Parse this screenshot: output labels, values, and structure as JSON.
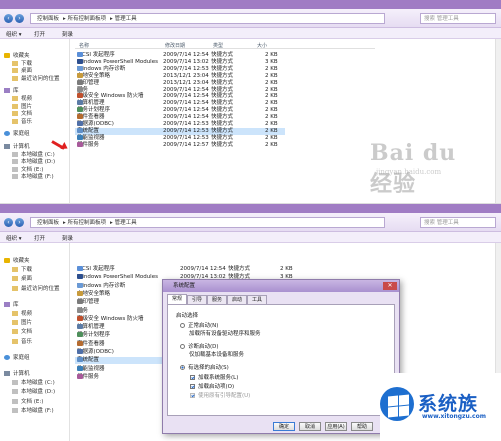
{
  "explorer": {
    "address": [
      "控制面板",
      "所有控制面板项",
      "管理工具"
    ],
    "search_placeholder": "搜索 管理工具",
    "toolbar": {
      "organize": "组织 ▾",
      "open": "打开",
      "burn": "刻录"
    },
    "columns": {
      "name": "名称",
      "modified": "修改日期",
      "type": "类型",
      "size": "大小"
    },
    "nav": [
      {
        "label": "收藏夹",
        "icon": "star-icon",
        "kind": "star",
        "indent": 0
      },
      {
        "label": "下载",
        "icon": "folder-icon",
        "kind": "folder",
        "indent": 1
      },
      {
        "label": "桌面",
        "icon": "folder-icon",
        "kind": "folder",
        "indent": 1
      },
      {
        "label": "最近访问的位置",
        "icon": "folder-icon",
        "kind": "folder",
        "indent": 1
      },
      {
        "label": "库",
        "icon": "library-icon",
        "kind": "lib",
        "indent": 0
      },
      {
        "label": "视频",
        "icon": "folder-icon",
        "kind": "folder",
        "indent": 1
      },
      {
        "label": "图片",
        "icon": "folder-icon",
        "kind": "folder",
        "indent": 1
      },
      {
        "label": "文档",
        "icon": "folder-icon",
        "kind": "folder",
        "indent": 1
      },
      {
        "label": "音乐",
        "icon": "folder-icon",
        "kind": "folder",
        "indent": 1
      },
      {
        "label": "家庭组",
        "icon": "network-icon",
        "kind": "net",
        "indent": 0
      },
      {
        "label": "计算机",
        "icon": "computer-icon",
        "kind": "pc",
        "indent": 0
      },
      {
        "label": "本地磁盘 (C:)",
        "icon": "drive-icon",
        "kind": "drive",
        "indent": 1
      },
      {
        "label": "本地磁盘 (D:)",
        "icon": "drive-icon",
        "kind": "drive",
        "indent": 1
      },
      {
        "label": "文档 (E:)",
        "icon": "drive-icon",
        "kind": "drive",
        "indent": 1
      },
      {
        "label": "本地磁盘 (F:)",
        "icon": "drive-icon",
        "kind": "drive",
        "indent": 1
      }
    ],
    "files": [
      {
        "name": "iSCSI 发起程序",
        "date": "2009/7/14 12:54",
        "type": "快捷方式",
        "size": "2 KB",
        "color": "#5a8fd8"
      },
      {
        "name": "Windows PowerShell Modules",
        "date": "2009/7/14 13:02",
        "type": "快捷方式",
        "size": "3 KB",
        "color": "#2d4f8f"
      },
      {
        "name": "Windows 内存诊断",
        "date": "2009/7/14 12:53",
        "type": "快捷方式",
        "size": "2 KB",
        "color": "#6a9ad6"
      },
      {
        "name": "本地安全策略",
        "date": "2013/12/1 23:04",
        "type": "快捷方式",
        "size": "2 KB",
        "color": "#c89b3c"
      },
      {
        "name": "打印管理",
        "date": "2013/12/1 23:04",
        "type": "快捷方式",
        "size": "2 KB",
        "color": "#7b7b7b"
      },
      {
        "name": "服务",
        "date": "2009/7/14 12:54",
        "type": "快捷方式",
        "size": "2 KB",
        "color": "#8a8a8a"
      },
      {
        "name": "高级安全 Windows 防火墙",
        "date": "2009/7/14 12:54",
        "type": "快捷方式",
        "size": "2 KB",
        "color": "#c0502d"
      },
      {
        "name": "计算机管理",
        "date": "2009/7/14 12:54",
        "type": "快捷方式",
        "size": "2 KB",
        "color": "#5b7ba6"
      },
      {
        "name": "任务计划程序",
        "date": "2009/7/14 12:54",
        "type": "快捷方式",
        "size": "2 KB",
        "color": "#4e8f5b"
      },
      {
        "name": "事件查看器",
        "date": "2009/7/14 12:54",
        "type": "快捷方式",
        "size": "2 KB",
        "color": "#b56b2f"
      },
      {
        "name": "数据源(ODBC)",
        "date": "2009/7/14 12:53",
        "type": "快捷方式",
        "size": "2 KB",
        "color": "#4f6fa8"
      },
      {
        "name": "系统配置",
        "date": "2009/7/14 12:53",
        "type": "快捷方式",
        "size": "2 KB",
        "color": "#5f8fc8"
      },
      {
        "name": "性能监视器",
        "date": "2009/7/14 12:53",
        "type": "快捷方式",
        "size": "2 KB",
        "color": "#3a7fb8"
      },
      {
        "name": "组件服务",
        "date": "2009/7/14 12:57",
        "type": "快捷方式",
        "size": "2 KB",
        "color": "#a85a9a"
      }
    ]
  },
  "watermark": {
    "main": "Bai du 经验",
    "sub": "jingyan.baidu.com"
  },
  "dialog": {
    "title": "系统配置",
    "close": "✕",
    "tabs": [
      "常规",
      "引导",
      "服务",
      "启动",
      "工具"
    ],
    "group_label": "启动选择",
    "options": [
      {
        "label": "正常启动(N)",
        "desc": "加载所有设备驱动程序和服务",
        "selected": false
      },
      {
        "label": "诊断启动(D)",
        "desc": "仅加载基本设备和服务",
        "selected": false
      },
      {
        "label": "有选择的启动(S)",
        "desc": "",
        "selected": true
      }
    ],
    "checks": [
      {
        "label": "加载系统服务(L)",
        "checked": true,
        "disabled": false
      },
      {
        "label": "加载启动项(O)",
        "checked": true,
        "disabled": false
      },
      {
        "label": "使用原有引导配置(U)",
        "checked": true,
        "disabled": true
      }
    ],
    "buttons": [
      "确定",
      "取消",
      "应用(A)",
      "帮助"
    ]
  },
  "brand": {
    "name": "系统族",
    "url": "www.xitongzu.com"
  }
}
